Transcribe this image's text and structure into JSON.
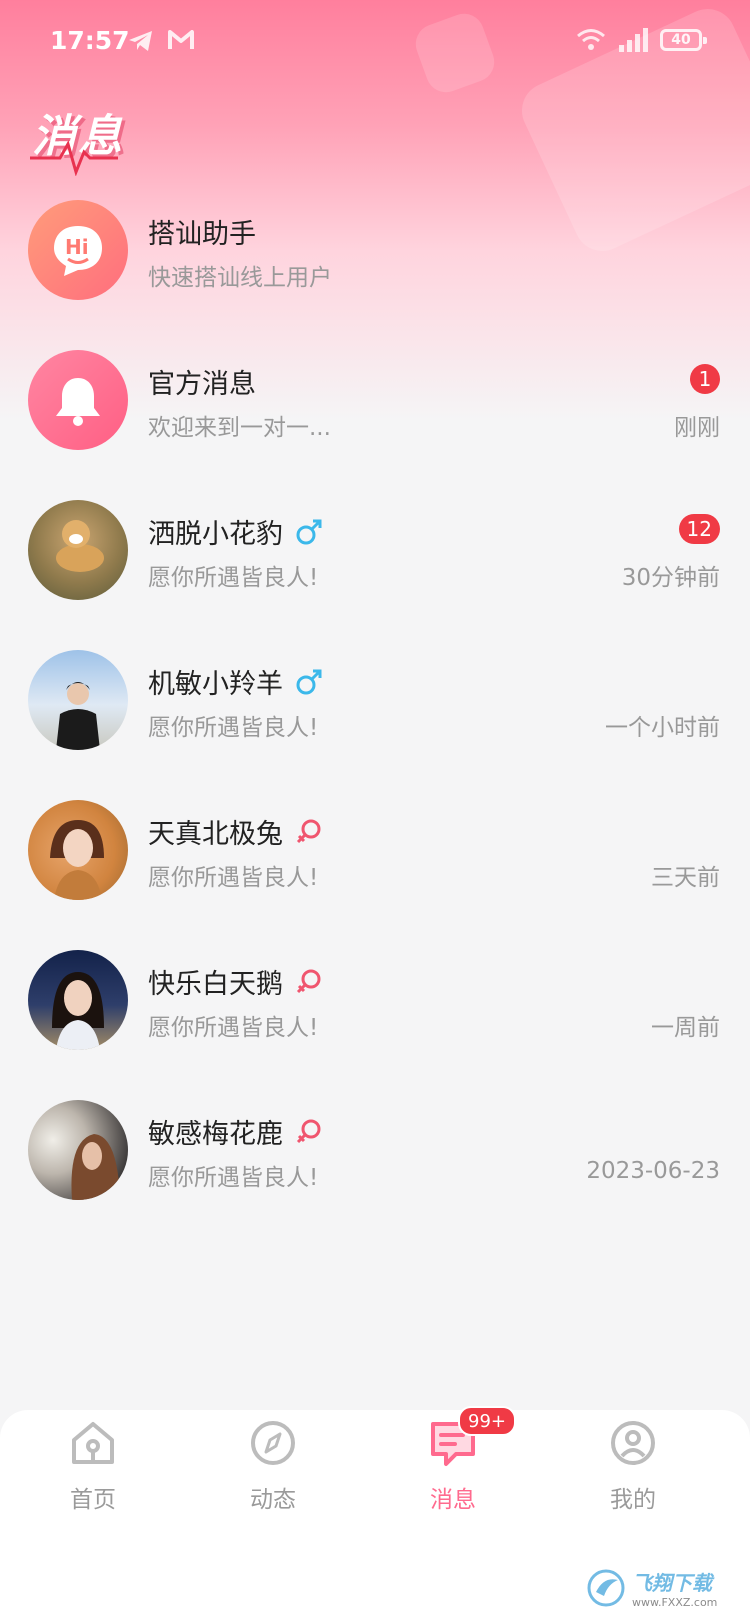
{
  "status_bar": {
    "time": "17:57",
    "battery": "40"
  },
  "header": {
    "title": "消息"
  },
  "messages": [
    {
      "name": "搭讪助手",
      "preview": "快速搭讪线上用户",
      "time": "",
      "badge": "",
      "gender": "",
      "avatar": "hi-icon"
    },
    {
      "name": "官方消息",
      "preview": "欢迎来到一对一...",
      "time": "刚刚",
      "badge": "1",
      "gender": "",
      "avatar": "bell-icon"
    },
    {
      "name": "洒脱小花豹",
      "preview": "愿你所遇皆良人!",
      "time": "30分钟前",
      "badge": "12",
      "gender": "male",
      "avatar": "dog-photo"
    },
    {
      "name": "机敏小羚羊",
      "preview": "愿你所遇皆良人!",
      "time": "一个小时前",
      "badge": "",
      "gender": "male",
      "avatar": "boy-photo"
    },
    {
      "name": "天真北极兔",
      "preview": "愿你所遇皆良人!",
      "time": "三天前",
      "badge": "",
      "gender": "female",
      "avatar": "girl-photo-1"
    },
    {
      "name": "快乐白天鹅",
      "preview": "愿你所遇皆良人!",
      "time": "一周前",
      "badge": "",
      "gender": "female",
      "avatar": "girl-photo-2"
    },
    {
      "name": "敏感梅花鹿",
      "preview": "愿你所遇皆良人!",
      "time": "2023-06-23",
      "badge": "",
      "gender": "female",
      "avatar": "girl-photo-3"
    }
  ],
  "tabbar": {
    "tabs": [
      {
        "label": "首页",
        "icon": "home-icon"
      },
      {
        "label": "动态",
        "icon": "compass-icon"
      },
      {
        "label": "消息",
        "icon": "message-icon",
        "badge": "99+"
      },
      {
        "label": "我的",
        "icon": "profile-icon"
      }
    ],
    "active": "消息"
  },
  "watermark": {
    "text": "飞翔下载",
    "sub": "www.FXXZ.com"
  },
  "colors": {
    "accent": "#ff6a8e",
    "badge": "#f03a45",
    "male": "#3bb8ea",
    "female": "#f0566f"
  }
}
